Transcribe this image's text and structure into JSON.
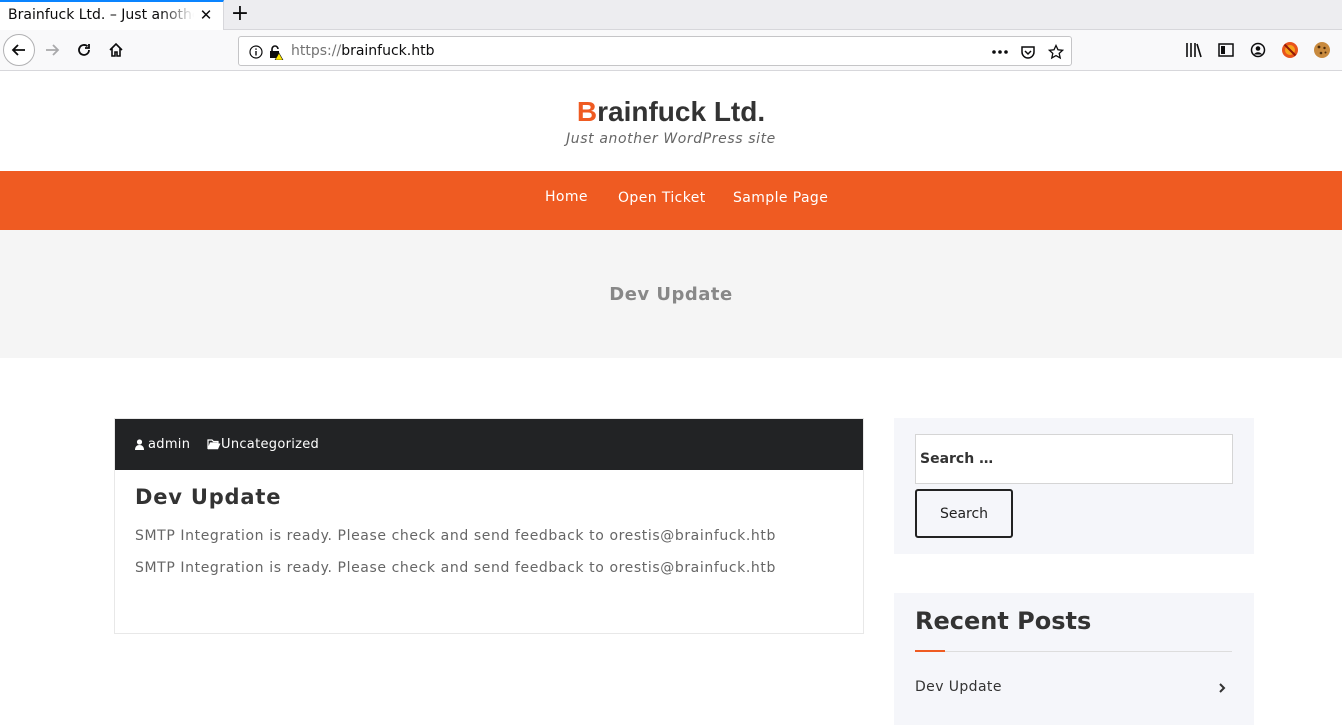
{
  "browser": {
    "tab_title": "Brainfuck Ltd. – Just another WordPress site",
    "url_scheme": "https://",
    "url_host": "brainfuck.htb",
    "accent": "#0a84ff"
  },
  "site": {
    "title_first_letter": "B",
    "title_rest": "rainfuck Ltd.",
    "tagline": "Just another WordPress site",
    "brand_color": "#ef5b22"
  },
  "menu": {
    "items": [
      {
        "label": "Home"
      },
      {
        "label": "Open Ticket"
      },
      {
        "label": "Sample Page"
      }
    ]
  },
  "banner": {
    "title": "Dev Update"
  },
  "post": {
    "author": "admin",
    "category": "Uncategorized",
    "title": "Dev Update",
    "lines": [
      "SMTP Integration is ready. Please check and send feedback to orestis@brainfuck.htb",
      "SMTP Integration is ready. Please check and send feedback to orestis@brainfuck.htb"
    ]
  },
  "sidebar": {
    "search": {
      "placeholder": "Search …",
      "button_label": "Search"
    },
    "recent": {
      "title": "Recent Posts",
      "items": [
        {
          "label": "Dev Update"
        }
      ]
    }
  }
}
